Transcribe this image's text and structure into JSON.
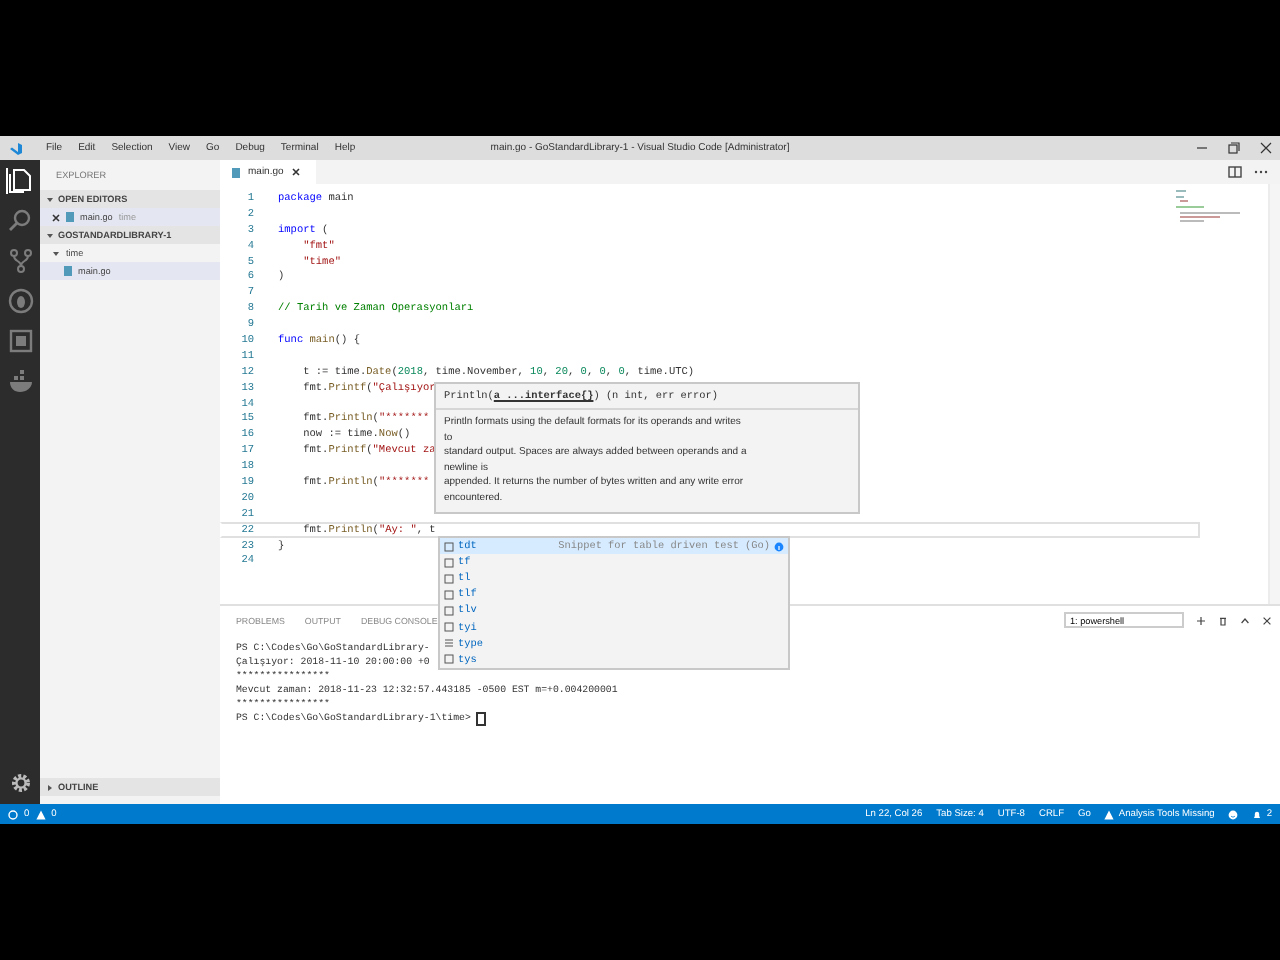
{
  "title_bar": {
    "menu": [
      "File",
      "Edit",
      "Selection",
      "View",
      "Go",
      "Debug",
      "Terminal",
      "Help"
    ],
    "title": "main.go - GoStandardLibrary-1 - Visual Studio Code [Administrator]"
  },
  "activity_bar": [
    {
      "kind": "files",
      "selected": true
    },
    {
      "kind": "search",
      "selected": false
    },
    {
      "kind": "source-control",
      "selected": false
    },
    {
      "kind": "debug",
      "selected": false
    },
    {
      "kind": "extensions",
      "selected": false
    },
    {
      "kind": "docker",
      "selected": false
    }
  ],
  "sidebar": {
    "title": "EXPLORER",
    "open_editors": {
      "title": "OPEN EDITORS",
      "expanded": true,
      "items": [
        {
          "label": "main.go",
          "description": "time",
          "selected": true
        }
      ]
    },
    "workspace": {
      "title": "GOSTANDARDLIBRARY-1",
      "expanded": true,
      "tree": [
        {
          "label": "time",
          "kind": "folder",
          "expanded": true,
          "selected": false,
          "children": [
            {
              "label": "main.go",
              "kind": "file",
              "selected": true
            }
          ]
        }
      ]
    },
    "outline": {
      "title": "OUTLINE",
      "expanded": false
    }
  },
  "tabs": [
    {
      "label": "main.go",
      "selected": true
    }
  ],
  "editor": {
    "lines": [
      {
        "number": "1",
        "current": false,
        "tokens": [
          {
            "kind": "keyword",
            "text": "package"
          },
          {
            "kind": "plain",
            "text": " main"
          }
        ]
      },
      {
        "number": "2",
        "current": false
      },
      {
        "number": "3",
        "current": false,
        "tokens": [
          {
            "kind": "keyword",
            "text": "import"
          },
          {
            "kind": "plain",
            "text": " ("
          }
        ]
      },
      {
        "number": "4",
        "current": false,
        "tokens": [
          {
            "kind": "string",
            "text": "    \"fmt\""
          }
        ]
      },
      {
        "number": "5",
        "current": false,
        "tokens": [
          {
            "kind": "string",
            "text": "    \"time\""
          }
        ]
      },
      {
        "number": "6",
        "current": false,
        "tokens": [
          {
            "kind": "plain",
            "text": ")"
          }
        ]
      },
      {
        "number": "7",
        "current": false
      },
      {
        "number": "8",
        "current": false,
        "tokens": [
          {
            "kind": "comment",
            "text": "// Tarih ve Zaman Operasyonları"
          }
        ]
      },
      {
        "number": "9",
        "current": false
      },
      {
        "number": "10",
        "current": false,
        "tokens": [
          {
            "kind": "keyword",
            "text": "func"
          },
          {
            "kind": "function",
            "text": " main"
          },
          {
            "kind": "plain",
            "text": "() {"
          }
        ]
      },
      {
        "number": "11",
        "current": false
      },
      {
        "number": "12",
        "current": false,
        "tokens": [
          {
            "kind": "plain",
            "text": "    t := time."
          },
          {
            "kind": "function",
            "text": "Date"
          },
          {
            "kind": "plain",
            "text": "("
          },
          {
            "kind": "number",
            "text": "2018"
          },
          {
            "kind": "plain",
            "text": ", time.November, "
          },
          {
            "kind": "number",
            "text": "10"
          },
          {
            "kind": "plain",
            "text": ", "
          },
          {
            "kind": "number",
            "text": "20"
          },
          {
            "kind": "plain",
            "text": ", "
          },
          {
            "kind": "number",
            "text": "0"
          },
          {
            "kind": "plain",
            "text": ", "
          },
          {
            "kind": "number",
            "text": "0"
          },
          {
            "kind": "plain",
            "text": ", "
          },
          {
            "kind": "number",
            "text": "0"
          },
          {
            "kind": "plain",
            "text": ", time.UTC)"
          }
        ]
      },
      {
        "number": "13",
        "current": false,
        "tokens": [
          {
            "kind": "plain",
            "text": "    fmt."
          },
          {
            "kind": "function",
            "text": "Printf"
          },
          {
            "kind": "plain",
            "text": "("
          },
          {
            "kind": "string",
            "text": "\"Çalışıyor"
          }
        ]
      },
      {
        "number": "14",
        "current": false
      },
      {
        "number": "15",
        "current": false,
        "tokens": [
          {
            "kind": "plain",
            "text": "    fmt."
          },
          {
            "kind": "function",
            "text": "Println"
          },
          {
            "kind": "plain",
            "text": "("
          },
          {
            "kind": "string",
            "text": "\"*******"
          }
        ]
      },
      {
        "number": "16",
        "current": false,
        "tokens": [
          {
            "kind": "plain",
            "text": "    now := time."
          },
          {
            "kind": "function",
            "text": "Now"
          },
          {
            "kind": "plain",
            "text": "()"
          }
        ]
      },
      {
        "number": "17",
        "current": false,
        "tokens": [
          {
            "kind": "plain",
            "text": "    fmt."
          },
          {
            "kind": "function",
            "text": "Printf"
          },
          {
            "kind": "plain",
            "text": "("
          },
          {
            "kind": "string",
            "text": "\"Mevcut za"
          }
        ]
      },
      {
        "number": "18",
        "current": false
      },
      {
        "number": "19",
        "current": false,
        "tokens": [
          {
            "kind": "plain",
            "text": "    fmt."
          },
          {
            "kind": "function",
            "text": "Println"
          },
          {
            "kind": "plain",
            "text": "("
          },
          {
            "kind": "string",
            "text": "\"*******"
          }
        ]
      },
      {
        "number": "20",
        "current": false
      },
      {
        "number": "21",
        "current": false
      },
      {
        "number": "22",
        "current": true,
        "tokens": [
          {
            "kind": "plain",
            "text": "    fmt."
          },
          {
            "kind": "function",
            "text": "Println"
          },
          {
            "kind": "plain",
            "text": "("
          },
          {
            "kind": "string",
            "text": "\"Ay: \""
          },
          {
            "kind": "plain",
            "text": ", t"
          }
        ]
      },
      {
        "number": "23",
        "current": false,
        "tokens": [
          {
            "kind": "plain",
            "text": "}"
          }
        ]
      },
      {
        "number": "24",
        "current": false
      }
    ]
  },
  "hover": {
    "signature": "Println(**a ...interface{}**) (n int, err error)",
    "doc_lines": [
      "Println formats using the default formats for its operands and writes",
      "to",
      "standard output. Spaces are always added between operands and a",
      "newline is",
      "appended. It returns the number of bytes written and any write error",
      "encountered."
    ]
  },
  "suggest": {
    "items": [
      {
        "label": "tdt",
        "kind": "snippet",
        "selected": true,
        "detail": "Snippet for table driven test (Go)"
      },
      {
        "label": "tf",
        "kind": "snippet",
        "selected": false
      },
      {
        "label": "tl",
        "kind": "snippet",
        "selected": false
      },
      {
        "label": "tlf",
        "kind": "snippet",
        "selected": false
      },
      {
        "label": "tlv",
        "kind": "snippet",
        "selected": false
      },
      {
        "label": "tyi",
        "kind": "snippet",
        "selected": false
      },
      {
        "label": "type",
        "kind": "keyword",
        "selected": false
      },
      {
        "label": "tys",
        "kind": "snippet",
        "selected": false
      }
    ]
  },
  "panel": {
    "tabs": [
      {
        "label": "PROBLEMS",
        "selected": false
      },
      {
        "label": "OUTPUT",
        "selected": false
      },
      {
        "label": "DEBUG CONSOLE",
        "selected": false
      }
    ],
    "terminal_select": "1: powershell",
    "terminal_lines": [
      "PS C:\\Codes\\Go\\GoStandardLibrary-",
      "Çalışıyor: 2018-11-10 20:00:00 +0",
      "****************",
      "Mevcut zaman: 2018-11-23 12:32:57.443185 -0500 EST m=+0.004200001",
      "****************",
      "PS C:\\Codes\\Go\\GoStandardLibrary-1\\time> "
    ]
  },
  "status_bar": {
    "errors": "0",
    "warnings": "0",
    "notifications": "2",
    "items": [
      {
        "kind": "text",
        "text": "Ln 22, Col 26"
      },
      {
        "kind": "text",
        "text": "Tab Size: 4"
      },
      {
        "kind": "text",
        "text": "UTF-8"
      },
      {
        "kind": "text",
        "text": "CRLF"
      },
      {
        "kind": "text",
        "text": "Go"
      },
      {
        "kind": "warning",
        "text": "Analysis Tools Missing"
      }
    ]
  }
}
